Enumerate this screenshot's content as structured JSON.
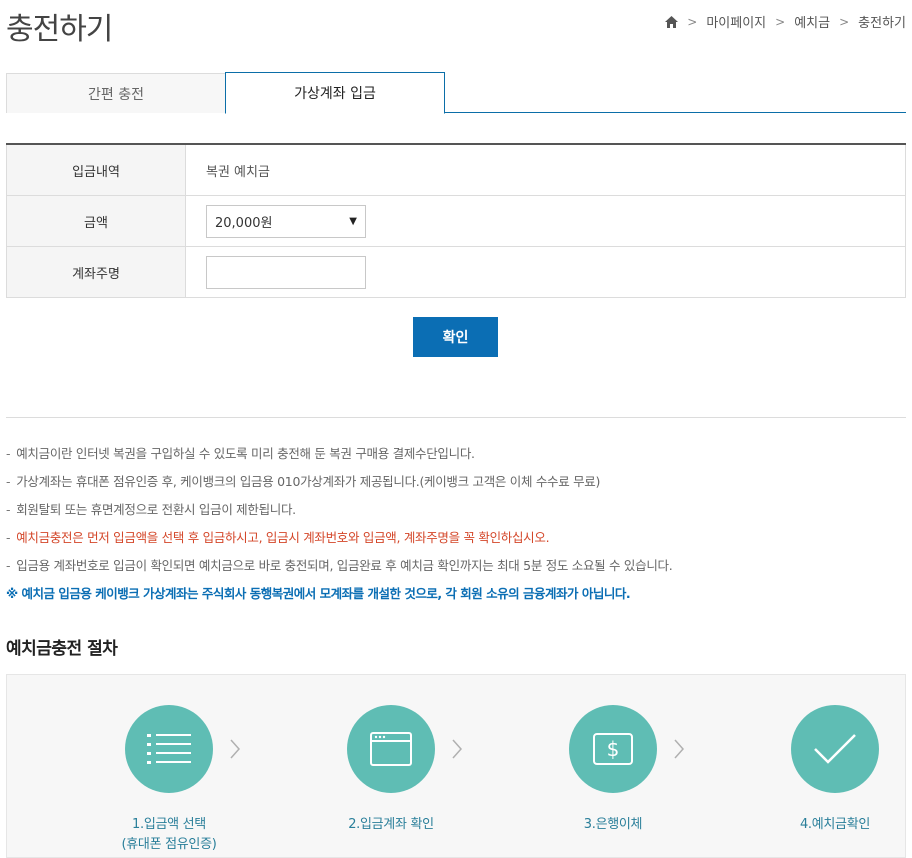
{
  "page": {
    "title": "충전하기"
  },
  "breadcrumb": {
    "home_icon": "home-icon",
    "items": [
      "마이페이지",
      "예치금",
      "충전하기"
    ],
    "separator": ">"
  },
  "tabs": [
    {
      "label": "간편 충전",
      "active": false
    },
    {
      "label": "가상계좌 입금",
      "active": true
    }
  ],
  "form": {
    "deposit_type": {
      "label": "입금내역",
      "value": "복권 예치금"
    },
    "amount": {
      "label": "금액",
      "selected": "20,000원"
    },
    "depositor": {
      "label": "계좌주명",
      "value": ""
    }
  },
  "confirm_label": "확인",
  "notes": [
    {
      "text": "예치금이란 인터넷 복권을 구입하실 수 있도록 미리 충전해 둔 복권 구매용 결제수단입니다.",
      "style": "normal"
    },
    {
      "text": "가상계좌는 휴대폰 점유인증 후, 케이뱅크의 입금용 010가상계좌가 제공됩니다.(케이뱅크 고객은 이체 수수료 무료)",
      "style": "normal"
    },
    {
      "text": "회원탈퇴 또는 휴면계정으로 전환시 입금이 제한됩니다.",
      "style": "normal"
    },
    {
      "text": "예치금충전은 먼저 입금액을 선택 후 입금하시고, 입금시 계좌번호와 입금액, 계좌주명을 꼭 확인하십시오.",
      "style": "red"
    },
    {
      "text": "입금용 계좌번호로 입금이 확인되면 예치금으로 바로 충전되며, 입금완료 후 예치금 확인까지는 최대 5분 정도 소요될 수 있습니다.",
      "style": "normal"
    }
  ],
  "notice": "※ 예치금 입금용 케이뱅크 가상계좌는 주식회사 동행복권에서 모계좌를 개설한 것으로, 각 회원 소유의 금융계좌가 아닙니다.",
  "procedure": {
    "title": "예치금충전 절차",
    "steps": [
      {
        "label": "1.입금액 선택",
        "sub": "(휴대폰 점유인증)",
        "icon": "list-icon"
      },
      {
        "label": "2.입금계좌 확인",
        "sub": "",
        "icon": "window-icon"
      },
      {
        "label": "3.은행이체",
        "sub": "",
        "icon": "dollar-icon"
      },
      {
        "label": "4.예치금확인",
        "sub": "",
        "icon": "checkmark-icon"
      }
    ]
  },
  "colors": {
    "accent": "#0b6eb4",
    "step_circle": "#5fbdb4",
    "warning": "#d4472a"
  }
}
